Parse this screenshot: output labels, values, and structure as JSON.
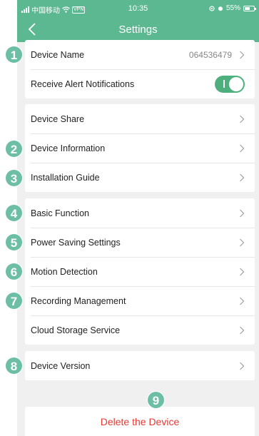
{
  "status_bar": {
    "carrier": "中国移动",
    "vpn": "VPN",
    "time": "10:35",
    "battery": "55%"
  },
  "nav": {
    "title": "Settings"
  },
  "groups": {
    "device": {
      "name_label": "Device Name",
      "name_value": "064536479",
      "alerts_label": "Receive Alert Notifications",
      "alerts_on": true
    },
    "info": {
      "share": "Device Share",
      "information": "Device Information",
      "guide": "Installation Guide"
    },
    "functions": {
      "basic": "Basic Function",
      "power": "Power Saving Settings",
      "motion": "Motion Detection",
      "recording": "Recording Management",
      "cloud": "Cloud Storage Service"
    },
    "version": {
      "label": "Device Version"
    }
  },
  "delete": {
    "label": "Delete the Device"
  },
  "callouts": [
    "1",
    "2",
    "3",
    "4",
    "5",
    "6",
    "7",
    "8",
    "9"
  ],
  "colors": {
    "header": "#5cb890",
    "toggle_on": "#4caf7d",
    "delete_text": "#e53935",
    "callout": "#6cbea4"
  }
}
